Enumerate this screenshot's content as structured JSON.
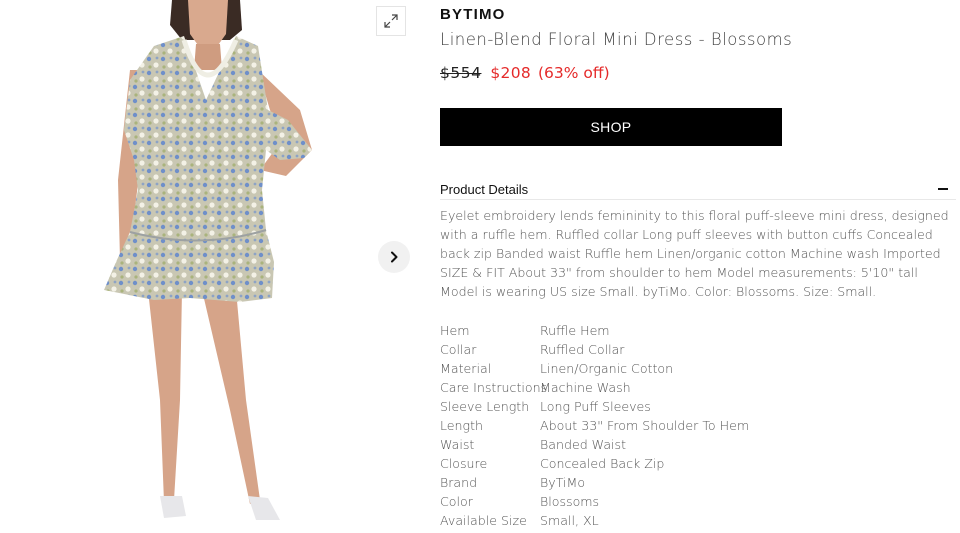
{
  "gallery": {
    "expand_icon": "expand-arrows-icon",
    "next_icon": "chevron-right-icon"
  },
  "product": {
    "brand": "BYTIMO",
    "title": "Linen-Blend Floral Mini Dress - Blossoms",
    "price_original": "$554",
    "price_sale": "$208",
    "discount": "(63% off)",
    "shop_label": "SHOP"
  },
  "details": {
    "heading": "Product Details",
    "collapse_icon": "minus-icon",
    "description": "Eyelet embroidery lends femininity to this floral puff-sleeve mini dress, designed with a ruffle hem. Ruffled collar Long puff sleeves with button cuffs Concealed back zip Banded waist Ruffle hem Linen/organic cotton Machine wash Imported SIZE & FIT About 33\" from shoulder to hem Model measurements: 5'10\" tall Model is wearing US size Small. byTiMo. Color: Blossoms. Size: Small.",
    "specs": [
      {
        "label": "Hem",
        "value": "Ruffle Hem"
      },
      {
        "label": "Collar",
        "value": "Ruffled Collar"
      },
      {
        "label": "Material",
        "value": "Linen/Organic Cotton"
      },
      {
        "label": "Care Instructions",
        "value": "Machine Wash"
      },
      {
        "label": "Sleeve Length",
        "value": "Long Puff Sleeves"
      },
      {
        "label": "Length",
        "value": "About 33\" From Shoulder To Hem"
      },
      {
        "label": "Waist",
        "value": "Banded Waist"
      },
      {
        "label": "Closure",
        "value": "Concealed Back Zip"
      },
      {
        "label": "Brand",
        "value": "ByTiMo"
      },
      {
        "label": "Color",
        "value": "Blossoms"
      },
      {
        "label": "Available Size",
        "value": "Small, XL"
      }
    ]
  },
  "colors": {
    "sale_red": "#e52a2a",
    "button_black": "#000000"
  }
}
